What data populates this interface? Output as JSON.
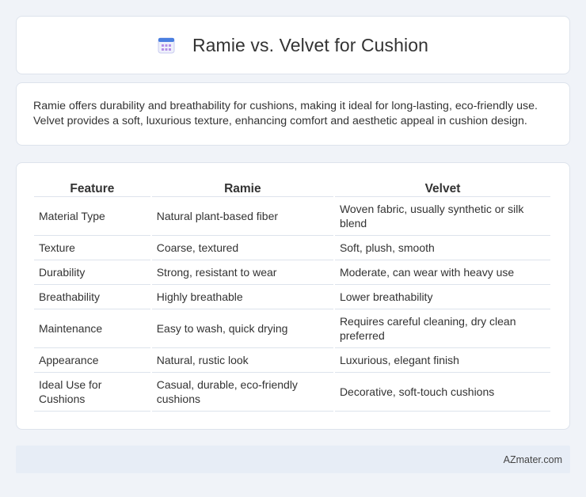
{
  "header": {
    "title": "Ramie vs. Velvet for Cushion",
    "icon": "calendar-icon"
  },
  "summary": {
    "text": "Ramie offers durability and breathability for cushions, making it ideal for long-lasting, eco-friendly use. Velvet provides a soft, luxurious texture, enhancing comfort and aesthetic appeal in cushion design."
  },
  "table": {
    "headers": [
      "Feature",
      "Ramie",
      "Velvet"
    ],
    "rows": [
      [
        "Material Type",
        "Natural plant-based fiber",
        "Woven fabric, usually synthetic or silk blend"
      ],
      [
        "Texture",
        "Coarse, textured",
        "Soft, plush, smooth"
      ],
      [
        "Durability",
        "Strong, resistant to wear",
        "Moderate, can wear with heavy use"
      ],
      [
        "Breathability",
        "Highly breathable",
        "Lower breathability"
      ],
      [
        "Maintenance",
        "Easy to wash, quick drying",
        "Requires careful cleaning, dry clean preferred"
      ],
      [
        "Appearance",
        "Natural, rustic look",
        "Luxurious, elegant finish"
      ],
      [
        "Ideal Use for Cushions",
        "Casual, durable, eco-friendly cushions",
        "Decorative, soft-touch cushions"
      ]
    ]
  },
  "footer": {
    "text": "AZmater.com"
  },
  "colors": {
    "background": "#f0f3f8",
    "card": "#ffffff",
    "border": "#dde3ec",
    "footer_bg": "#e7edf6",
    "icon_accent": "#4a7fe0",
    "icon_grid": "#b48ee8"
  }
}
